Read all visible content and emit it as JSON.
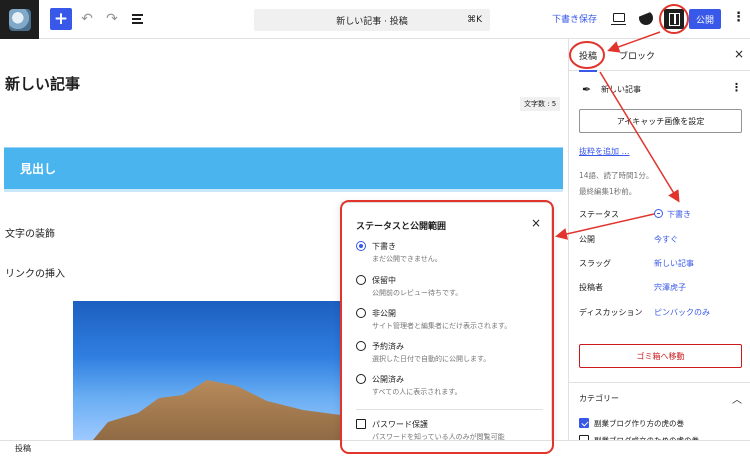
{
  "topbar": {
    "command_bar_text": "新しい記事 · 投稿",
    "command_bar_shortcut": "⌘K",
    "save_draft_label": "下書き保存",
    "publish_label": "公開",
    "add_icon": "+",
    "undo_icon": "↶",
    "redo_icon": "↷",
    "more_icon": "⋮"
  },
  "editor": {
    "title": "新しい記事",
    "char_count": "文字数 : 5",
    "heading": "見出し",
    "paragraphs": [
      "文字の装飾",
      "リンクの挿入"
    ]
  },
  "status_popover": {
    "title": "ステータスと公開範囲",
    "close_icon": "×",
    "options": [
      {
        "label": "下書き",
        "desc": "まだ公開できません。",
        "checked": true
      },
      {
        "label": "保留中",
        "desc": "公開前のレビュー待ちです。",
        "checked": false
      },
      {
        "label": "非公開",
        "desc": "サイト管理者と編集者にだけ表示されます。",
        "checked": false
      },
      {
        "label": "予約済み",
        "desc": "選択した日付で自動的に公開します。",
        "checked": false
      },
      {
        "label": "公開済み",
        "desc": "すべての人に表示されます。",
        "checked": false
      }
    ],
    "password": {
      "label": "パスワード保護",
      "desc": "パスワードを知っている人のみが閲覧可能"
    }
  },
  "sidebar": {
    "tabs": [
      "投稿",
      "ブロック"
    ],
    "close_icon": "×",
    "post_title": "新しい記事",
    "featured_image_button": "アイキャッチ画像を設定",
    "excerpt_link": "抜粋を追加 …",
    "read_info_line1": "14語、読了時間1分。",
    "read_info_line2": "最終編集1秒前。",
    "meta": [
      {
        "key": "ステータス",
        "value": "下書き"
      },
      {
        "key": "公開",
        "value": "今すぐ"
      },
      {
        "key": "スラッグ",
        "value": "新しい記事"
      },
      {
        "key": "投稿者",
        "value": "宍澤虎子"
      },
      {
        "key": "ディスカッション",
        "value": "ピンバックのみ"
      }
    ],
    "trash_button": "ゴミ箱へ移動",
    "categories_header": "カテゴリー",
    "categories": [
      {
        "label": "副業ブログ作り方の虎の巻",
        "checked": true
      },
      {
        "label": "副業ブログ成立のための虎の巻",
        "checked": false
      }
    ]
  },
  "footer": {
    "breadcrumb": "投稿"
  },
  "colors": {
    "accent": "#3858e9",
    "annotation": "#e0342c",
    "heading_block": "#4ab4ee",
    "danger": "#cc1818"
  }
}
